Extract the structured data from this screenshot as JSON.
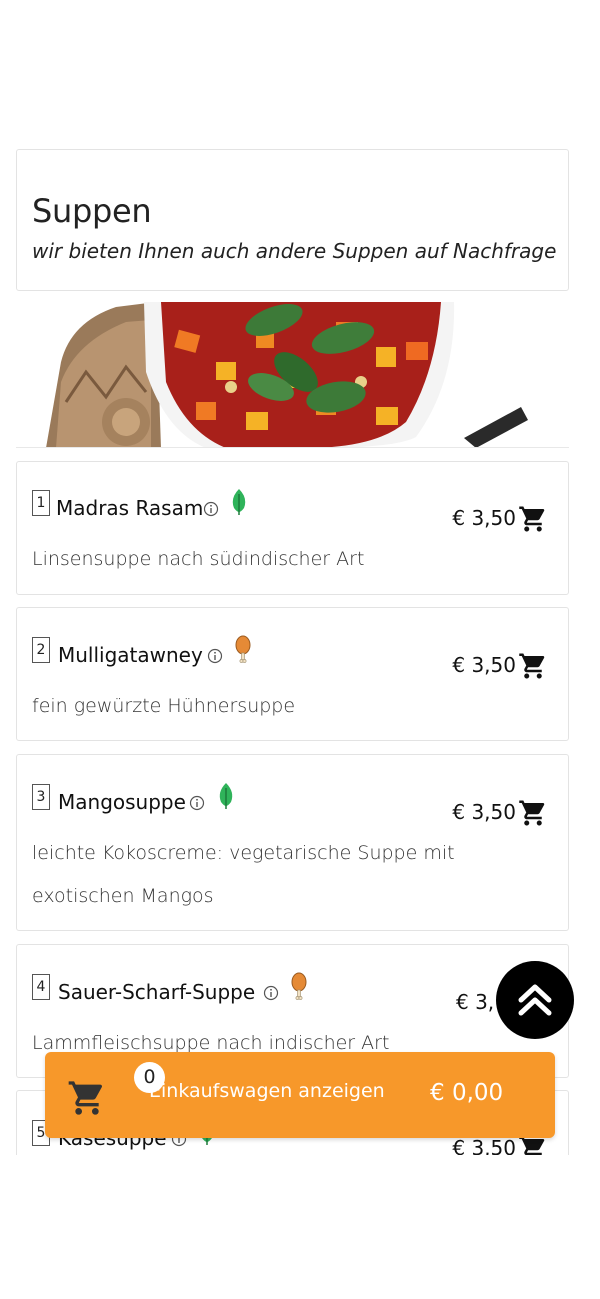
{
  "category": {
    "title": "Suppen",
    "subtitle": "wir bieten Ihnen auch andere Suppen auf Nachfrage"
  },
  "items": [
    {
      "number": "1",
      "name": "Madras Rasam",
      "diet_icon": "leaf-icon",
      "price": "€ 3,50",
      "description": "Linsensuppe nach südindischer Art"
    },
    {
      "number": "2",
      "name": "Mulligatawney",
      "diet_icon": "chicken-leg-icon",
      "price": "€ 3,50",
      "description": "fein gewürzte Hühnersuppe"
    },
    {
      "number": "3",
      "name": "Mangosuppe",
      "diet_icon": "leaf-icon",
      "price": "€ 3,50",
      "description": "leichte Kokoscreme: vegetarische Suppe mit exotischen Mangos"
    },
    {
      "number": "4",
      "name": "Sauer-Scharf-Suppe",
      "diet_icon": "chicken-leg-icon",
      "price": "€ 3,",
      "description": "Lammfleischsuppe nach indischer Art"
    },
    {
      "number": "5",
      "name": "Käsesuppe",
      "diet_icon": "leaf-icon",
      "price": "€ 3,50",
      "description": ""
    }
  ],
  "cart": {
    "count": "0",
    "label": "Einkaufswagen anzeigen",
    "total": "€ 0,00"
  },
  "colors": {
    "accent": "#f7982a",
    "leaf": "#2fb35a",
    "chicken": "#e58a36"
  }
}
